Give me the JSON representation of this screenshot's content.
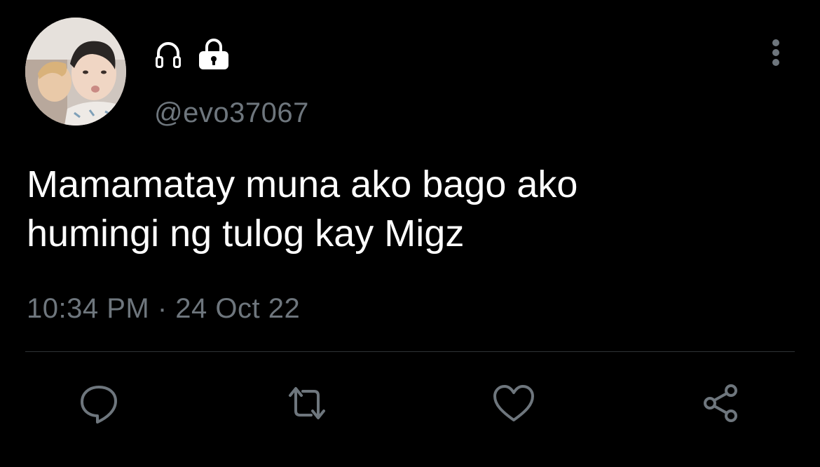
{
  "tweet": {
    "handle": "@evo37067",
    "text": "Mamamatay muna ako bago ako\nhumingi ng tulog kay Migz",
    "timestamp": "10:34 PM · 24 Oct 22",
    "badges": [
      "headphones-icon",
      "lock-icon"
    ]
  },
  "actions": [
    {
      "name": "reply",
      "icon": "speech-bubble-icon"
    },
    {
      "name": "retweet",
      "icon": "retweet-icon"
    },
    {
      "name": "like",
      "icon": "heart-icon"
    },
    {
      "name": "share",
      "icon": "share-icon"
    }
  ],
  "colors": {
    "background": "#000000",
    "text": "#ffffff",
    "muted": "#6e767d",
    "divider": "#2f3336"
  }
}
